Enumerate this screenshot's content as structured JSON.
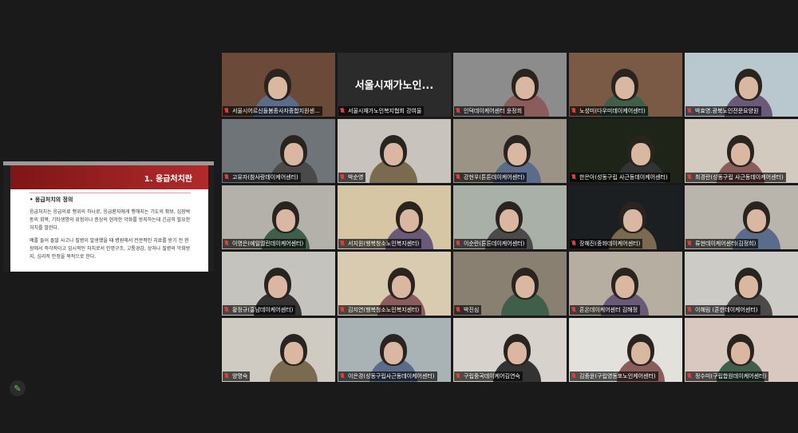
{
  "screen_share": {
    "slide_title": "1. 응급처치란",
    "section_heading": "• 응급처치의 정의",
    "paragraph1": "응급처치는 응급의료 행위의 하나로, 응급환자에게 행해지는 기도의 확보, 심장박동의 회복, 기타생명의 위험이나 증상의 현저한 악화를 방지하는데 긴급히 필요한 처치를 말한다.",
    "paragraph2": "예를 들어 돌발 사고나 질병이 발생했을 때 병원에서 전문적인 치료를 받기 전 현장에서 즉각적이고 임시적인 처치로서 인명구조, 고통경감, 상처나 질병의 악화방지, 심리적 안정을 목적으로 한다."
  },
  "annotate_button": {
    "icon": "pencil-icon"
  },
  "participants": [
    {
      "name": "서울시어르신돌봄종사자종합지원센...",
      "muted": true,
      "wall": "#6b4a3a"
    },
    {
      "name": "서울시재가노인복지협회 강여울",
      "muted": true,
      "wall": "#2b2b2b",
      "display_text": "서울시재가노인..."
    },
    {
      "name": "인덕데이케어센터 윤정희",
      "muted": true,
      "wall": "#8c8c8c"
    },
    {
      "name": "노성미(다우미데이케어센터)",
      "muted": true,
      "wall": "#7a5a44"
    },
    {
      "name": "박효영.광북노인전문요양원",
      "muted": true,
      "wall": "#b9c7cf",
      "active": true
    },
    {
      "name": "고유자(참사랑데이케어센터)",
      "muted": true,
      "wall": "#6e7478"
    },
    {
      "name": "박순영",
      "muted": true,
      "wall": "#c8c3bd"
    },
    {
      "name": "강현우(튼튼데이케어센터)",
      "muted": true,
      "wall": "#9a9386"
    },
    {
      "name": "한은아(성동구립 사근동데이케어센터)",
      "muted": true,
      "wall": "#1f2418"
    },
    {
      "name": "최경란(성동구립 사근동데이케어센터)",
      "muted": true,
      "wall": "#d2c9bf"
    },
    {
      "name": "이영은(예일엘린데이케어센터)",
      "muted": true,
      "wall": "#b4b1aa"
    },
    {
      "name": "서지원(행복청소노인복지센터)",
      "muted": true,
      "wall": "#d6c6a4"
    },
    {
      "name": "이순란(튼튼데이케어센터)",
      "muted": true,
      "wall": "#a8b0a7"
    },
    {
      "name": "장혜진(중화데이케어센터)",
      "muted": true,
      "wall": "#1c1f22"
    },
    {
      "name": "류현데이케어센터(김정희)",
      "muted": true,
      "wall": "#b9b5ac"
    },
    {
      "name": "황정규(홍남데이케어센터)",
      "muted": true,
      "wall": "#c5c3be"
    },
    {
      "name": "김지연(행복청소노인복지센터)",
      "muted": true,
      "wall": "#d8cbb0"
    },
    {
      "name": "박진심",
      "muted": true,
      "wall": "#8a8072"
    },
    {
      "name": "혼온데이케어센터 김해정",
      "muted": true,
      "wall": "#b7aea2"
    },
    {
      "name": "이혜림 (혼한데이케어센터)",
      "muted": true,
      "wall": "#cdcbc6"
    },
    {
      "name": "양명숙",
      "muted": true,
      "wall": "#cfcbc3"
    },
    {
      "name": "이은경(성동구립사근동데이케어센터)",
      "muted": true,
      "wall": "#a9b3b5"
    },
    {
      "name": "구립중곡데이케어김연숙",
      "muted": true,
      "wall": "#d7d3cc"
    },
    {
      "name": "김종윤(구립영동포노인케어센터)",
      "muted": true,
      "wall": "#e3e1dc"
    },
    {
      "name": "정수미(구립합원데이케어센터)",
      "muted": true,
      "wall": "#d9c8c0"
    }
  ]
}
